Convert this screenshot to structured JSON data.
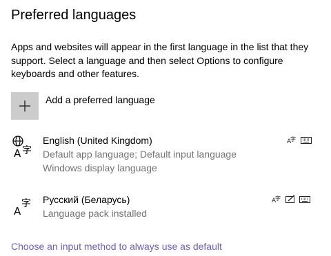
{
  "header": {
    "title": "Preferred languages"
  },
  "description": "Apps and websites will appear in the first language in the list that they support. Select a language and then select Options to configure keyboards and other features.",
  "add_language": {
    "label": "Add a preferred language",
    "icon": "plus-icon"
  },
  "languages": [
    {
      "name": "English (United Kingdom)",
      "details": [
        "Default app language; Default input language",
        "Windows display language"
      ],
      "icon": "language-globe-icon",
      "features": [
        "speech-icon",
        "keyboard-icon"
      ]
    },
    {
      "name": "Русский (Беларусь)",
      "details": [
        "Language pack installed"
      ],
      "icon": "language-icon",
      "features": [
        "speech-icon",
        "handwriting-icon",
        "keyboard-icon"
      ]
    }
  ],
  "link": {
    "label": "Choose an input method to always use as default",
    "color": "#6b5fb8"
  }
}
